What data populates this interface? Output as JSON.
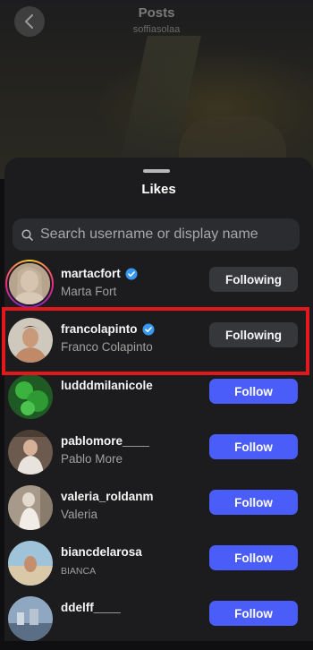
{
  "header": {
    "title": "Posts",
    "subtitle": "soffiasolaa"
  },
  "sheet": {
    "title": "Likes",
    "search": {
      "placeholder": "Search username or display name",
      "value": ""
    }
  },
  "users": [
    {
      "username": "martacfort",
      "display_name": "Marta Fort",
      "verified": true,
      "button": "Following",
      "story_ring": true
    },
    {
      "username": "francolapinto",
      "display_name": "Franco Colapinto",
      "verified": true,
      "button": "Following",
      "highlighted": true
    },
    {
      "username": "ludddmilanicole",
      "display_name": "",
      "verified": false,
      "button": "Follow"
    },
    {
      "username": "pablomore____",
      "display_name": "Pablo More",
      "verified": false,
      "button": "Follow"
    },
    {
      "username": "valeria_roldanm",
      "display_name": "Valeria",
      "verified": false,
      "button": "Follow"
    },
    {
      "username": "biancdelarosa",
      "display_name": "BIANCA",
      "verified": false,
      "button": "Follow"
    },
    {
      "username": "ddelff____",
      "display_name": "",
      "verified": false,
      "button": "Follow"
    }
  ],
  "colors": {
    "follow_blue": "#4a5df9",
    "highlight_red": "#e2181c",
    "verified_blue": "#3897f0"
  }
}
